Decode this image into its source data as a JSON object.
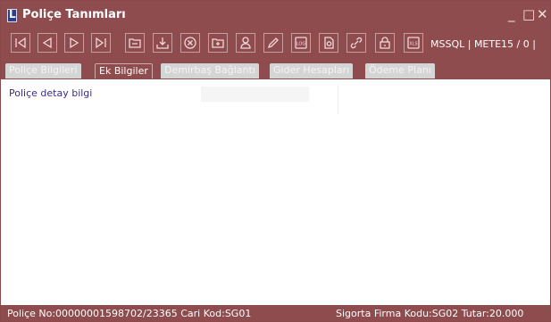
{
  "window": {
    "title": "Poliçe Tanımları",
    "logo_letter": "L",
    "minimize_glyph": "_",
    "maximize_glyph": "□",
    "close_glyph": "✕"
  },
  "toolbar": {
    "buttons": [
      {
        "name": "first-record-icon"
      },
      {
        "name": "previous-record-icon"
      },
      {
        "name": "next-record-icon"
      },
      {
        "name": "last-record-icon"
      },
      {
        "name": "folder-icon"
      },
      {
        "name": "download-icon"
      },
      {
        "name": "cancel-icon"
      },
      {
        "name": "add-icon"
      },
      {
        "name": "user-icon"
      },
      {
        "name": "edit-icon"
      },
      {
        "name": "log-icon"
      },
      {
        "name": "document-icon"
      },
      {
        "name": "link-icon"
      },
      {
        "name": "lock-icon"
      },
      {
        "name": "excel-icon"
      }
    ],
    "log_label": "LOG",
    "xls_label": "XLS",
    "server_info": "MSSQL | METE15 / 0 |"
  },
  "tabs": [
    {
      "label": "Poliçe Bilgileri",
      "active": false
    },
    {
      "label": "Ek Bilgiler",
      "active": true
    },
    {
      "label": "Demirbaş Bağlantı",
      "active": false
    },
    {
      "label": "Gider Hesapları",
      "active": false
    },
    {
      "label": "Ödeme Planı",
      "active": false
    }
  ],
  "form": {
    "detail_label": "Poliçe detay bilgi",
    "detail_value": ""
  },
  "status": {
    "left": "Poliçe No:00000001598702/23365  Cari Kod:SG01",
    "right": "Sigorta Firma Kodu:SG02 Tutar:20.000"
  },
  "colors": {
    "chrome": "#8e4c4e",
    "inactive_tab": "#d5d5d5",
    "label_text": "#3e2a86"
  }
}
